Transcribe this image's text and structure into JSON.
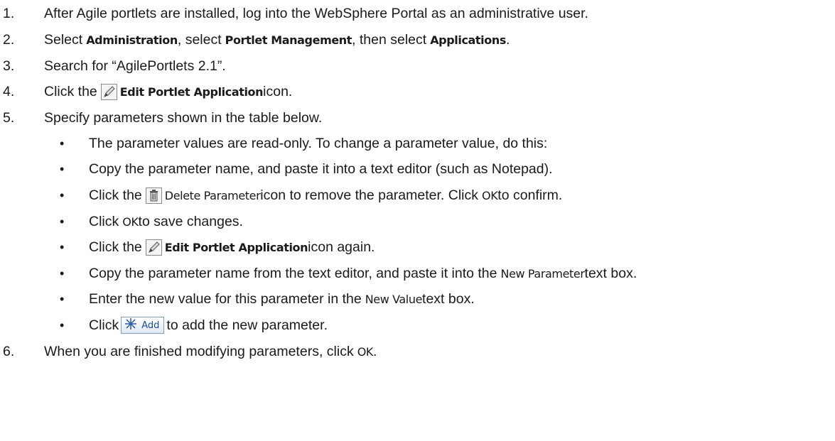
{
  "steps": [
    {
      "num": "1.",
      "text": "After Agile portlets are installed, log into the WebSphere Portal as an administrative user."
    },
    {
      "num": "2.",
      "p1": "Select ",
      "ui1": "Administration",
      "p2": ", select ",
      "ui2": "Portlet Management",
      "p3": ", then select ",
      "ui3": "Applications",
      "p4": "."
    },
    {
      "num": "3.",
      "text": "Search for “AgilePortlets 2.1”."
    },
    {
      "num": "4.",
      "p1": "Click the ",
      "ui1": "Edit Portlet Application",
      "p2": " icon."
    },
    {
      "num": "5.",
      "text": "Specify parameters shown in the table below."
    },
    {
      "num": "6.",
      "p1": "When you are finished modifying parameters, click ",
      "ui1": "OK",
      "p2": "."
    }
  ],
  "bullets": [
    {
      "text": "The parameter values are read-only. To change a parameter value, do this:"
    },
    {
      "text": "Copy the parameter name, and paste it into a text editor (such as Notepad)."
    },
    {
      "p1": "Click the ",
      "ui1": "Delete Parameter",
      "p2": " icon to remove the parameter. Click ",
      "ui2": "OK",
      "p3": " to confirm."
    },
    {
      "p1": "Click ",
      "ui1": "OK",
      "p2": " to save changes."
    },
    {
      "p1": "Click the ",
      "ui1": "Edit Portlet Application",
      "p2": " icon again."
    },
    {
      "p1": "Copy the parameter name from the text editor, and paste it into the ",
      "ui1": "New Parameter",
      "p2": " text box."
    },
    {
      "p1": "Enter the new value for this parameter in the ",
      "ui1": "New Value",
      "p2": " text box."
    },
    {
      "p1": "Click ",
      "button": "Add",
      "p2": " to add the new parameter."
    }
  ],
  "bullet_char": "•",
  "icons": {
    "edit": "pencil-icon",
    "delete": "trash-icon",
    "add": "asterisk-star-icon"
  }
}
